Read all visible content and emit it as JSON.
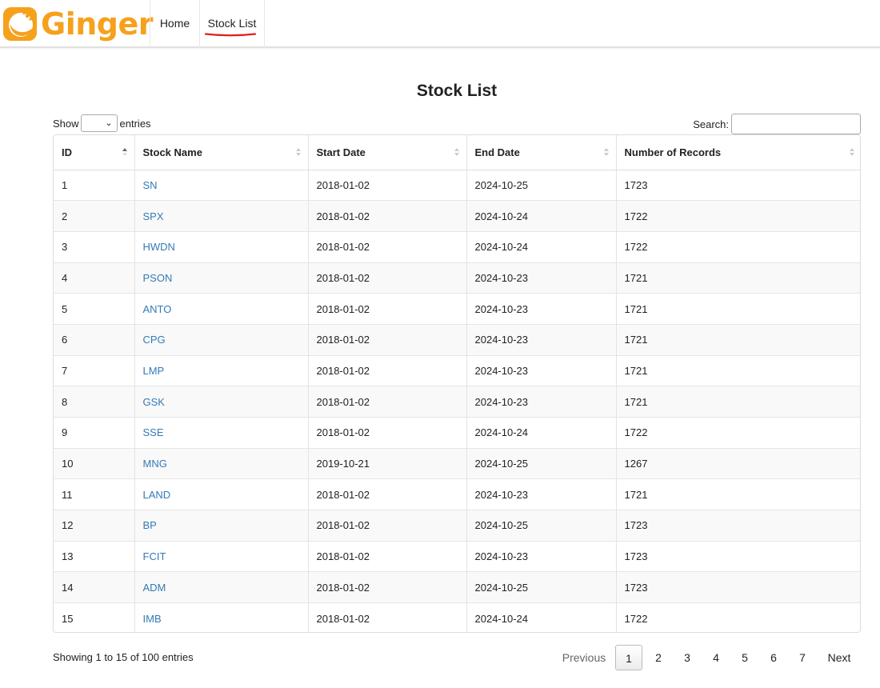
{
  "brand": {
    "name": "Ginger",
    "color": "#f6a11c"
  },
  "nav": {
    "home": "Home",
    "stock_list": "Stock List",
    "active_underline_color": "#e0201c"
  },
  "page": {
    "title": "Stock List"
  },
  "controls": {
    "show_label": "Show",
    "entries_label": "entries",
    "search_label": "Search:",
    "search_value": "",
    "length_value": ""
  },
  "table": {
    "columns": [
      "ID",
      "Stock Name",
      "Start Date",
      "End Date",
      "Number of Records"
    ],
    "sorted_column": "ID",
    "link_color": "#337ab7",
    "rows": [
      [
        "1",
        "SN",
        "2018-01-02",
        "2024-10-25",
        "1723"
      ],
      [
        "2",
        "SPX",
        "2018-01-02",
        "2024-10-24",
        "1722"
      ],
      [
        "3",
        "HWDN",
        "2018-01-02",
        "2024-10-24",
        "1722"
      ],
      [
        "4",
        "PSON",
        "2018-01-02",
        "2024-10-23",
        "1721"
      ],
      [
        "5",
        "ANTO",
        "2018-01-02",
        "2024-10-23",
        "1721"
      ],
      [
        "6",
        "CPG",
        "2018-01-02",
        "2024-10-23",
        "1721"
      ],
      [
        "7",
        "LMP",
        "2018-01-02",
        "2024-10-23",
        "1721"
      ],
      [
        "8",
        "GSK",
        "2018-01-02",
        "2024-10-23",
        "1721"
      ],
      [
        "9",
        "SSE",
        "2018-01-02",
        "2024-10-24",
        "1722"
      ],
      [
        "10",
        "MNG",
        "2019-10-21",
        "2024-10-25",
        "1267"
      ],
      [
        "11",
        "LAND",
        "2018-01-02",
        "2024-10-23",
        "1721"
      ],
      [
        "12",
        "BP",
        "2018-01-02",
        "2024-10-25",
        "1723"
      ],
      [
        "13",
        "FCIT",
        "2018-01-02",
        "2024-10-23",
        "1723"
      ],
      [
        "14",
        "ADM",
        "2018-01-02",
        "2024-10-25",
        "1723"
      ],
      [
        "15",
        "IMB",
        "2018-01-02",
        "2024-10-24",
        "1722"
      ]
    ]
  },
  "footer": {
    "info": "Showing 1 to 15 of 100 entries",
    "previous": "Previous",
    "next": "Next",
    "pages": [
      "1",
      "2",
      "3",
      "4",
      "5",
      "6",
      "7"
    ],
    "current_page": "1"
  }
}
